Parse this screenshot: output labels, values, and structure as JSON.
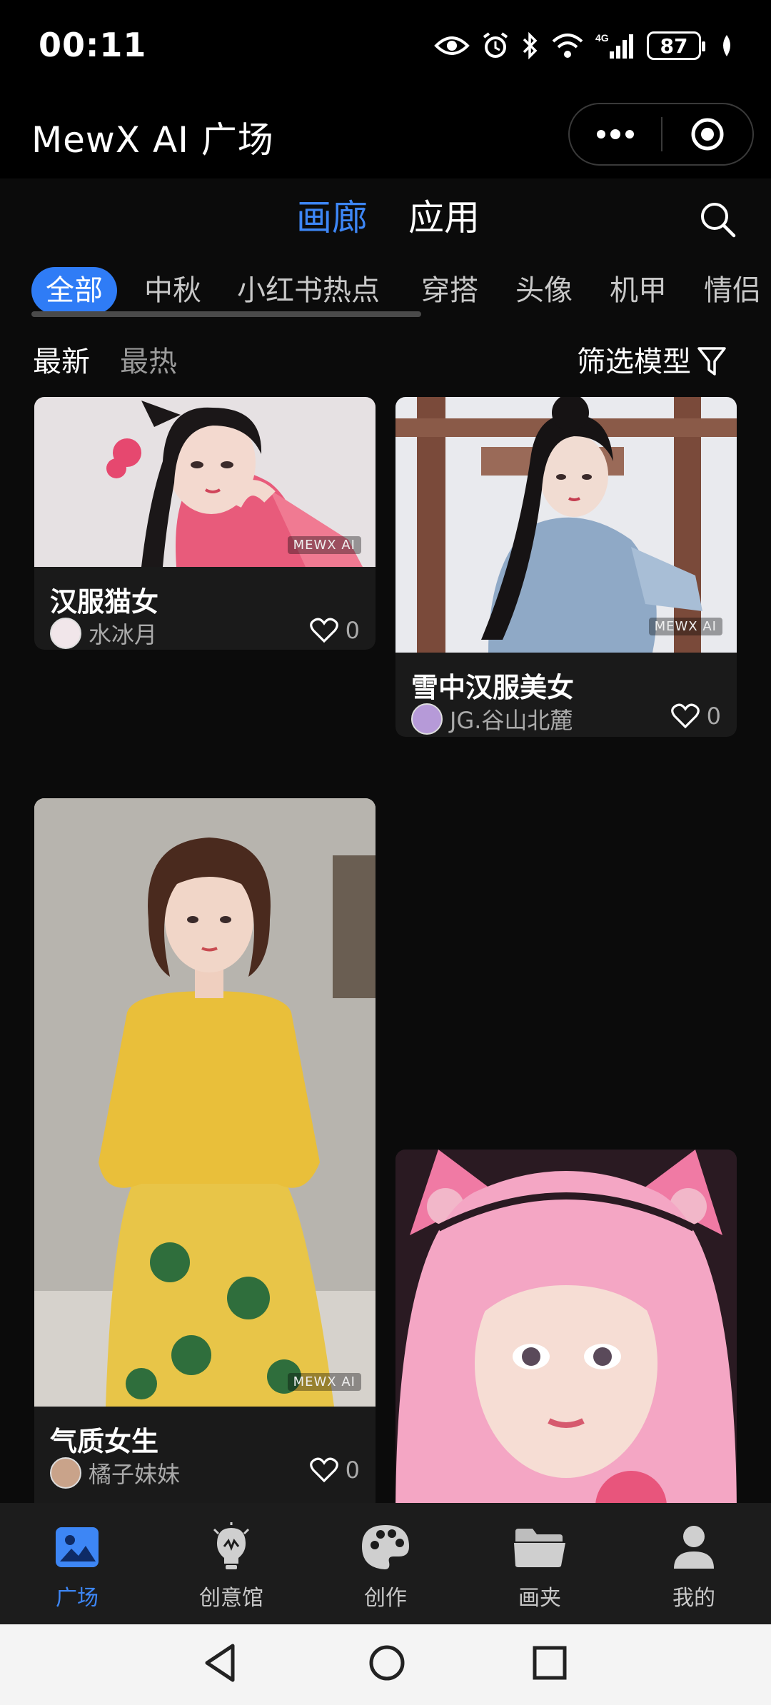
{
  "status_bar": {
    "time": "00:11",
    "battery": "87"
  },
  "header": {
    "title": "MewX AI 广场"
  },
  "top_tabs": [
    {
      "label": "画廊",
      "active": true
    },
    {
      "label": "应用",
      "active": false
    }
  ],
  "categories": [
    "全部",
    "中秋",
    "小红书热点",
    "穿搭",
    "头像",
    "机甲",
    "情侣"
  ],
  "sort": {
    "latest": "最新",
    "hottest": "最热",
    "filter_label": "筛选模型"
  },
  "cards": [
    {
      "title": "汉服猫女",
      "author": "水冰月",
      "likes": "0",
      "watermark": "MEWX AI"
    },
    {
      "title": "雪中汉服美女",
      "author": "JG.谷山北麓",
      "likes": "0",
      "watermark": "MEWX AI"
    },
    {
      "title": "气质女生",
      "author": "橘子妹妹",
      "likes": "0",
      "watermark": "MEWX AI"
    },
    {
      "title": "",
      "author": "",
      "likes": ""
    }
  ],
  "bottom_nav": [
    {
      "label": "广场",
      "icon": "image-icon",
      "active": true
    },
    {
      "label": "创意馆",
      "icon": "lightbulb-icon",
      "active": false
    },
    {
      "label": "创作",
      "icon": "palette-icon",
      "active": false
    },
    {
      "label": "画夹",
      "icon": "folder-icon",
      "active": false
    },
    {
      "label": "我的",
      "icon": "user-icon",
      "active": false
    }
  ],
  "colors": {
    "accent": "#3d86f5",
    "background": "#0b0b0b",
    "card": "#1a1a1a"
  }
}
